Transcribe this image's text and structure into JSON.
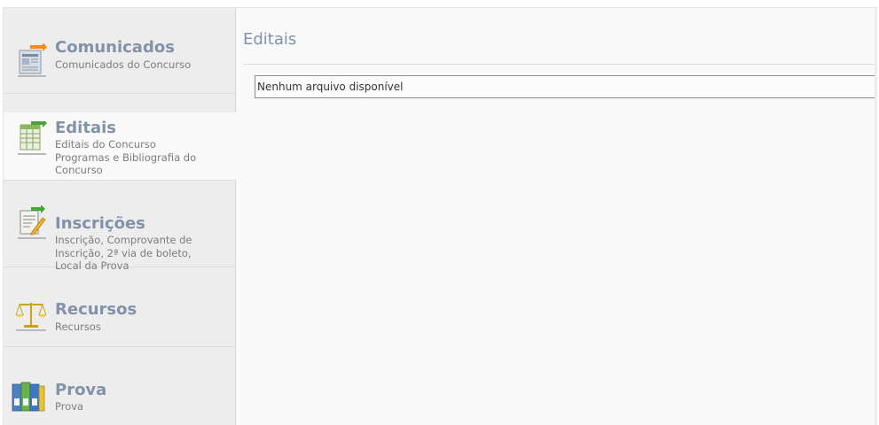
{
  "sidebar": {
    "items": [
      {
        "title": "Comunicados",
        "desc": "Comunicados do Concurso",
        "icon": "newspaper-icon"
      },
      {
        "title": "Editais",
        "desc": "Editais do Concurso Programas e Bibliografia do Concurso",
        "icon": "spreadsheet-icon",
        "active": true
      },
      {
        "title": "Inscrições",
        "desc": "Inscrição, Comprovante de Inscrição, 2ª via de boleto, Local da Prova",
        "icon": "form-pencil-icon"
      },
      {
        "title": "Recursos",
        "desc": "Recursos",
        "icon": "scales-icon"
      },
      {
        "title": "Prova",
        "desc": "Prova",
        "icon": "binders-icon"
      }
    ]
  },
  "main": {
    "title": "Editais",
    "empty_message": "Nenhum arquivo disponível"
  },
  "colors": {
    "heading": "#8292a8",
    "sidebar_bg": "#ededed",
    "active_bg": "#f9f9f9"
  }
}
